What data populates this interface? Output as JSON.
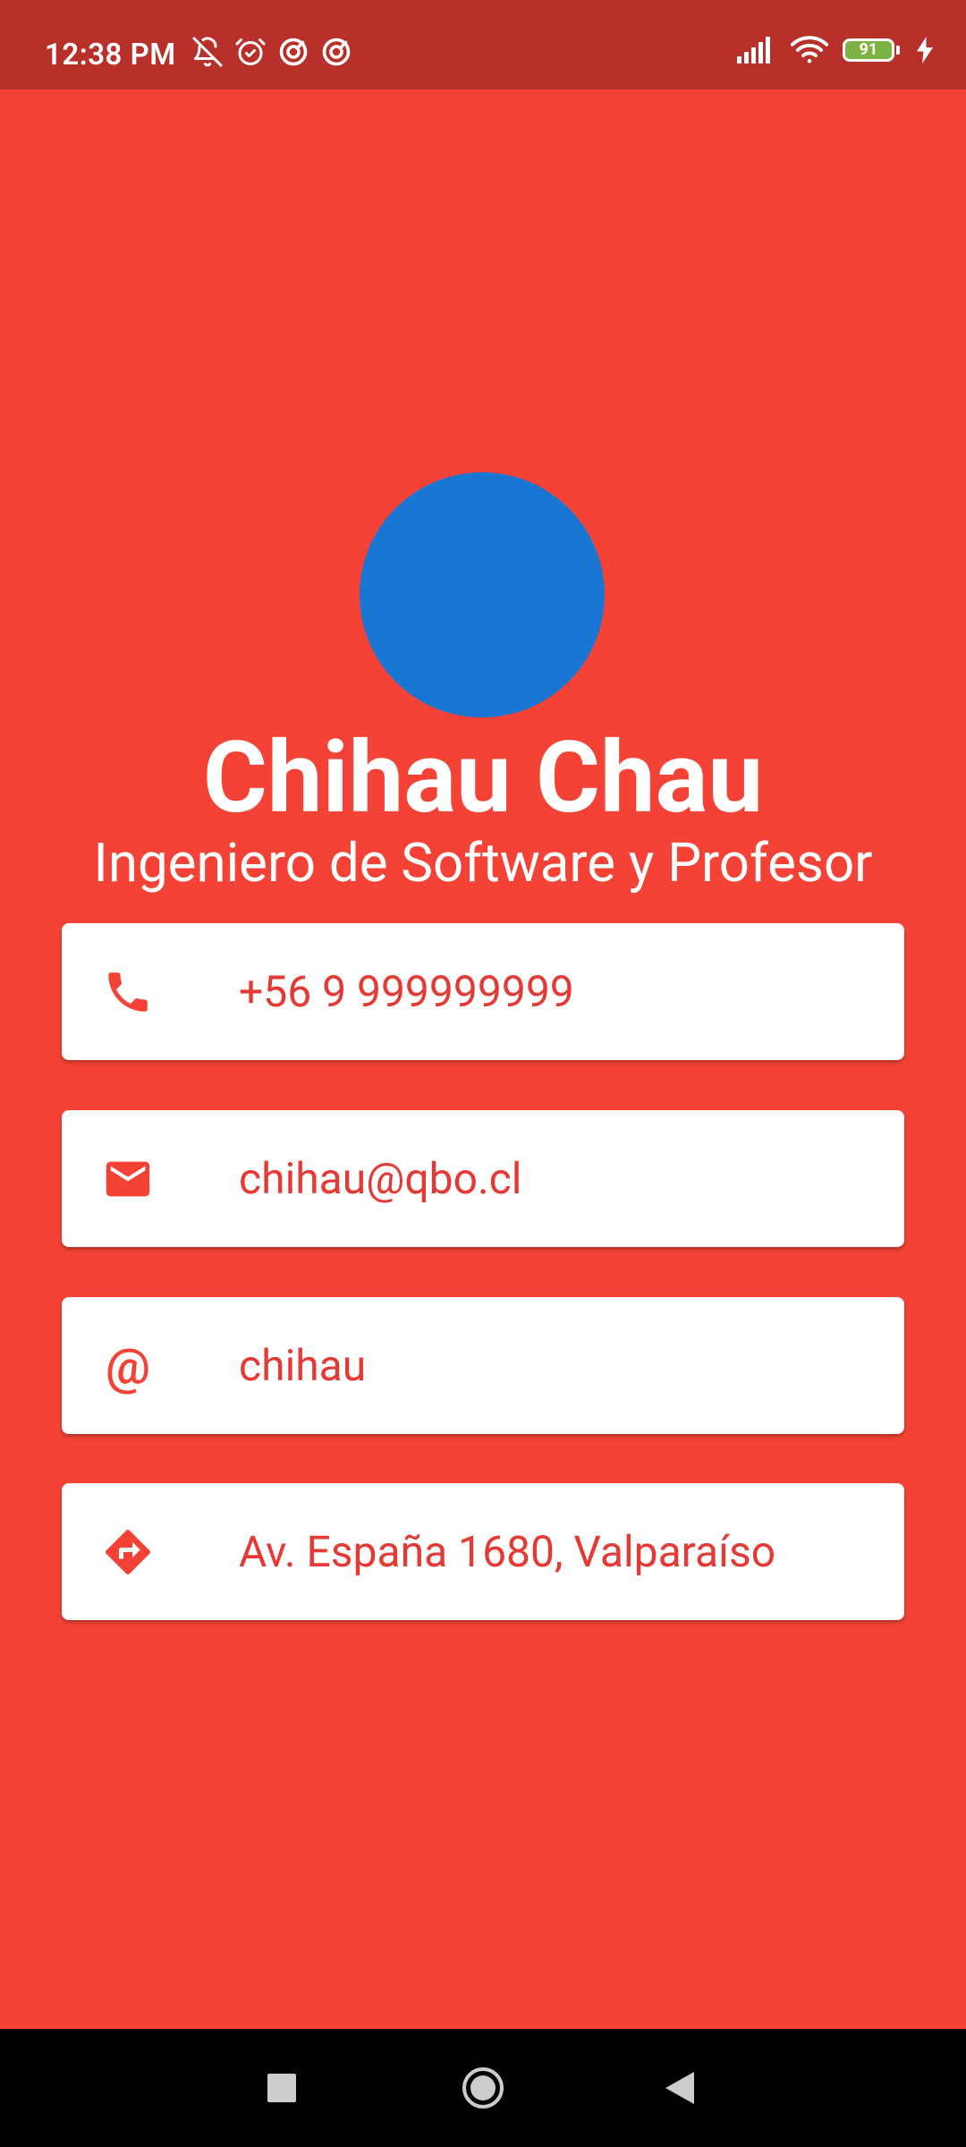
{
  "status_bar": {
    "time": "12:38 PM",
    "battery_level": "91",
    "left_icons": [
      "notifications-off-icon",
      "alarm-icon",
      "sync-icon",
      "sync-icon"
    ],
    "right_icons": [
      "signal-icon",
      "wifi-icon",
      "battery-icon",
      "charging-icon"
    ]
  },
  "profile": {
    "name": "Chihau Chau",
    "subtitle": "Ingeniero de Software y Profesor",
    "avatar_color": "#1976D2"
  },
  "contacts": [
    {
      "icon": "phone-icon",
      "text": "+56 9 999999999"
    },
    {
      "icon": "email-icon",
      "text": "chihau@qbo.cl"
    },
    {
      "icon": "at-icon",
      "glyph": "@",
      "text": "chihau"
    },
    {
      "icon": "directions-icon",
      "text": "Av. España 1680, Valparaíso"
    }
  ],
  "navigation": {
    "buttons": [
      "recents-button",
      "home-button",
      "back-button"
    ]
  },
  "colors": {
    "background": "#F44336",
    "status_bar": "#B8302A",
    "accent": "#E53935",
    "card": "#ffffff"
  }
}
